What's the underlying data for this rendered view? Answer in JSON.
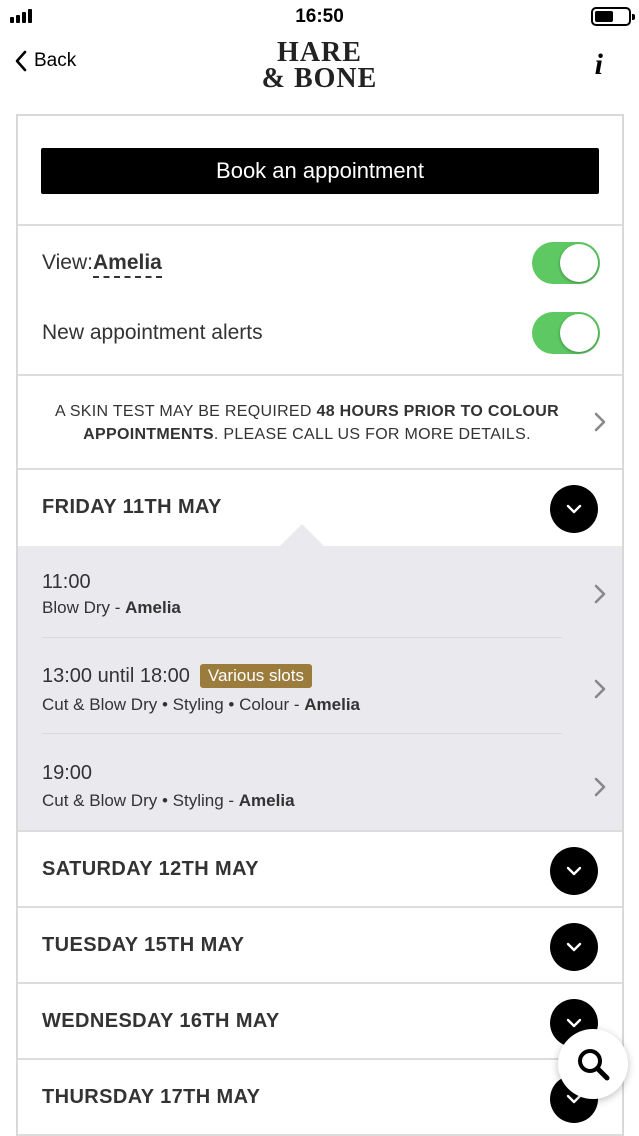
{
  "status_bar": {
    "time": "16:50"
  },
  "nav": {
    "back_label": "Back",
    "logo_line1": "HARE",
    "logo_line2": "& BONE",
    "info_label": "i"
  },
  "booking": {
    "button_label": "Book an appointment"
  },
  "settings": {
    "view_label": "View:",
    "view_value": "Amelia",
    "view_toggle_on": true,
    "alerts_label": "New appointment alerts",
    "alerts_toggle_on": true,
    "toggle_color": "#5ec962"
  },
  "notice": {
    "text_a": "A SKIN TEST MAY BE REQUIRED ",
    "text_b": "48 HOURS PRIOR TO COLOUR APPOINTMENTS",
    "text_c": ". PLEASE CALL US FOR MORE DETAILS."
  },
  "days": [
    {
      "title": "FRIDAY 11TH MAY",
      "expanded": true
    },
    {
      "title": "SATURDAY 12TH MAY",
      "expanded": false
    },
    {
      "title": "TUESDAY 15TH MAY",
      "expanded": false
    },
    {
      "title": "WEDNESDAY 16TH MAY",
      "expanded": false
    },
    {
      "title": "THURSDAY 17TH MAY",
      "expanded": false
    }
  ],
  "slots": [
    {
      "time": "11:00",
      "badge": "",
      "services": "Blow Dry - ",
      "stylist": "Amelia"
    },
    {
      "time": "13:00 until 18:00",
      "badge": "Various slots",
      "services": "Cut & Blow Dry • Styling • Colour - ",
      "stylist": "Amelia"
    },
    {
      "time": "19:00",
      "badge": "",
      "services": "Cut & Blow Dry • Styling - ",
      "stylist": "Amelia"
    }
  ],
  "colors": {
    "badge": "#9c7c3c",
    "accent_black": "#000000"
  },
  "icons": {
    "back": "chevron-left-icon",
    "info": "info-icon",
    "search": "search-icon",
    "expand": "chevron-down-icon",
    "row": "chevron-right-icon"
  }
}
